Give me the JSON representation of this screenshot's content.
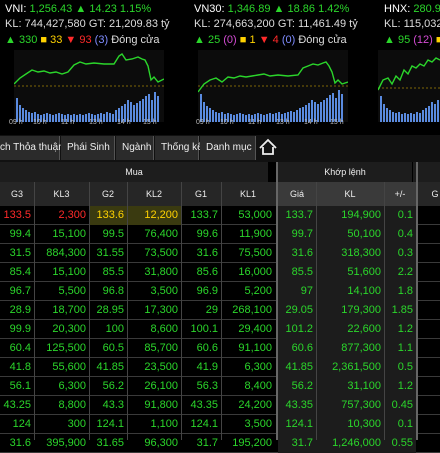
{
  "indices": [
    {
      "name": "VNI:",
      "value": "1,256.43",
      "change": "14.23",
      "pct": "1.15%",
      "kl_label": "KL:",
      "kl": "744,427,580",
      "gt_label": "GT:",
      "gt": "21,209.83 tỷ",
      "up": "330",
      "ref": "33",
      "down": "93",
      "cnt": "(3)",
      "status": "Đóng cửa"
    },
    {
      "name": "VN30:",
      "value": "1,346.89",
      "change": "18.86",
      "pct": "1.42%",
      "kl_label": "KL:",
      "kl": "274,663,200",
      "gt_label": "GT:",
      "gt": "11,461.49 tỷ",
      "up": "25",
      "ceil": "(0)",
      "ref": "1",
      "down": "4",
      "floor": "(0)",
      "status": "Đóng cửa"
    },
    {
      "name": "HNX:",
      "value": "280.9",
      "kl_label": "KL:",
      "kl": "115,032,",
      "up": "95",
      "ceil": "(12)",
      "ref": "14"
    }
  ],
  "time_ticks": [
    "09 h",
    "10 h",
    "11 h",
    "13 h",
    "14 h",
    "15 h"
  ],
  "tabs": [
    "ch Thỏa thuận",
    "Phái Sinh",
    "Ngành",
    "Thống kê",
    "Danh mục"
  ],
  "groups": {
    "mua": "Mua",
    "khop": "Khớp lệnh"
  },
  "columns": [
    "G3",
    "KL3",
    "G2",
    "KL2",
    "G1",
    "KL1",
    "Giá",
    "KL",
    "+/-",
    "G"
  ],
  "rows": [
    {
      "c": [
        "133.5",
        "2,300",
        "133.6",
        "12,200",
        "133.7",
        "53,000",
        "133.7",
        "194,900",
        "0.1",
        ""
      ],
      "k": [
        "r",
        "r",
        "y",
        "y",
        "g",
        "g",
        "g",
        "g",
        "g",
        "g"
      ]
    },
    {
      "c": [
        "99.4",
        "15,100",
        "99.5",
        "76,400",
        "99.6",
        "11,900",
        "99.7",
        "50,100",
        "0.4",
        ""
      ],
      "k": [
        "g",
        "g",
        "g",
        "g",
        "g",
        "g",
        "g",
        "g",
        "g",
        "g"
      ]
    },
    {
      "c": [
        "31.5",
        "884,300",
        "31.55",
        "73,500",
        "31.6",
        "75,500",
        "31.6",
        "318,300",
        "0.3",
        ""
      ],
      "k": [
        "g",
        "g",
        "g",
        "g",
        "g",
        "g",
        "g",
        "g",
        "g",
        "g"
      ]
    },
    {
      "c": [
        "85.4",
        "15,100",
        "85.5",
        "31,800",
        "85.6",
        "16,000",
        "85.5",
        "51,600",
        "2.2",
        ""
      ],
      "k": [
        "g",
        "g",
        "g",
        "g",
        "g",
        "g",
        "g",
        "g",
        "g",
        "g"
      ]
    },
    {
      "c": [
        "96.7",
        "5,500",
        "96.8",
        "3,500",
        "96.9",
        "5,200",
        "97",
        "14,100",
        "1.8",
        ""
      ],
      "k": [
        "g",
        "g",
        "g",
        "g",
        "g",
        "g",
        "g",
        "g",
        "g",
        "g"
      ]
    },
    {
      "c": [
        "28.9",
        "18,700",
        "28.95",
        "17,300",
        "29",
        "268,100",
        "29.05",
        "179,300",
        "1.85",
        ""
      ],
      "k": [
        "g",
        "g",
        "g",
        "g",
        "g",
        "g",
        "g",
        "g",
        "g",
        "g"
      ]
    },
    {
      "c": [
        "99.9",
        "20,300",
        "100",
        "8,600",
        "100.1",
        "29,400",
        "101.2",
        "22,600",
        "1.2",
        ""
      ],
      "k": [
        "g",
        "g",
        "g",
        "g",
        "g",
        "g",
        "g",
        "g",
        "g",
        "g"
      ]
    },
    {
      "c": [
        "60.4",
        "125,500",
        "60.5",
        "85,700",
        "60.6",
        "91,100",
        "60.6",
        "877,300",
        "1.1",
        ""
      ],
      "k": [
        "g",
        "g",
        "g",
        "g",
        "g",
        "g",
        "g",
        "g",
        "g",
        "g"
      ]
    },
    {
      "c": [
        "41.8",
        "55,600",
        "41.85",
        "23,500",
        "41.9",
        "6,300",
        "41.85",
        "2,361,500",
        "0.5",
        ""
      ],
      "k": [
        "g",
        "g",
        "g",
        "g",
        "g",
        "g",
        "g",
        "g",
        "g",
        "g"
      ]
    },
    {
      "c": [
        "56.1",
        "6,300",
        "56.2",
        "26,100",
        "56.3",
        "8,400",
        "56.2",
        "31,100",
        "1.2",
        ""
      ],
      "k": [
        "g",
        "g",
        "g",
        "g",
        "g",
        "g",
        "g",
        "g",
        "g",
        "g"
      ]
    },
    {
      "c": [
        "43.25",
        "8,800",
        "43.3",
        "91,800",
        "43.35",
        "24,200",
        "43.35",
        "757,300",
        "0.45",
        ""
      ],
      "k": [
        "g",
        "g",
        "g",
        "g",
        "g",
        "g",
        "g",
        "g",
        "g",
        "g"
      ]
    },
    {
      "c": [
        "124",
        "300",
        "124.1",
        "1,100",
        "124.1",
        "3,500",
        "124.1",
        "10,300",
        "0.1",
        ""
      ],
      "k": [
        "g",
        "g",
        "g",
        "g",
        "g",
        "g",
        "g",
        "g",
        "g",
        "g"
      ]
    },
    {
      "c": [
        "31.6",
        "395,900",
        "31.65",
        "96,300",
        "31.7",
        "195,200",
        "31.7",
        "1,246,000",
        "0.55",
        ""
      ],
      "k": [
        "g",
        "g",
        "g",
        "g",
        "g",
        "g",
        "g",
        "g",
        "g",
        "g"
      ]
    }
  ],
  "colors": {
    "g": "#2bd62b",
    "r": "#ff2a2a",
    "y": "#ffd200"
  }
}
